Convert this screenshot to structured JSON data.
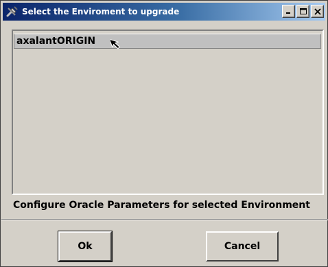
{
  "window": {
    "title": "Select the Enviroment to upgrade",
    "title_icon": "tools-icon",
    "controls": [
      "minimize-icon",
      "maximize-icon",
      "close-icon"
    ]
  },
  "environment_list": {
    "items": [
      {
        "label": "axalantORIGIN",
        "selected": true
      }
    ]
  },
  "config_label": "Configure Oracle Parameters for selected Environment",
  "buttons": {
    "ok_label": "Ok",
    "cancel_label": "Cancel"
  }
}
